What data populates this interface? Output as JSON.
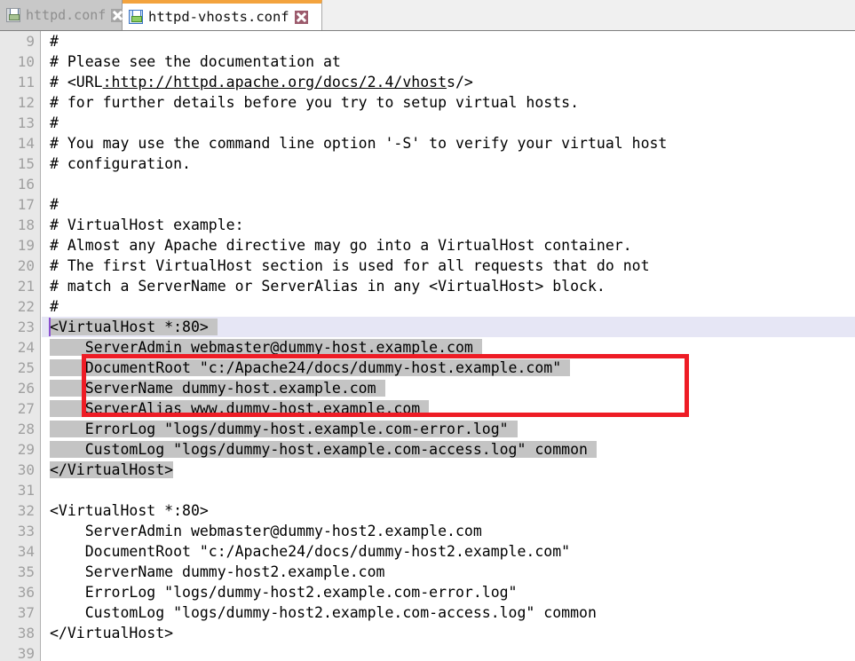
{
  "window": {
    "title": "httpd-vhosts.conf",
    "accent_orange": "#f3a33e",
    "selection_color": "#c4c4c4",
    "current_line_color": "#e6e6f5",
    "annotation_color": "#ee1c25"
  },
  "tabs": [
    {
      "label": "httpd.conf",
      "icon": "floppy-disk-icon",
      "close_icon": "close-icon",
      "active": false
    },
    {
      "label": "httpd-vhosts.conf",
      "icon": "floppy-disk-icon",
      "close_icon": "close-icon",
      "active": true
    }
  ],
  "editor": {
    "first_line_number": 9,
    "lines": [
      {
        "n": 9,
        "text": "#"
      },
      {
        "n": 10,
        "text": "# Please see the documentation at"
      },
      {
        "n": 11,
        "text": "# <URL:http://httpd.apache.org/docs/2.4/vhosts/>",
        "link_from": 6,
        "link_to": 45
      },
      {
        "n": 12,
        "text": "# for further details before you try to setup virtual hosts."
      },
      {
        "n": 13,
        "text": "#"
      },
      {
        "n": 14,
        "text": "# You may use the command line option '-S' to verify your virtual host"
      },
      {
        "n": 15,
        "text": "# configuration."
      },
      {
        "n": 16,
        "text": ""
      },
      {
        "n": 17,
        "text": "#"
      },
      {
        "n": 18,
        "text": "# VirtualHost example:"
      },
      {
        "n": 19,
        "text": "# Almost any Apache directive may go into a VirtualHost container."
      },
      {
        "n": 20,
        "text": "# The first VirtualHost section is used for all requests that do not"
      },
      {
        "n": 21,
        "text": "# match a ServerName or ServerAlias in any <VirtualHost> block."
      },
      {
        "n": 22,
        "text": "#"
      },
      {
        "n": 23,
        "text": "<VirtualHost *:80>",
        "selected": true,
        "sel_pad": 1,
        "current": true,
        "caret": true
      },
      {
        "n": 24,
        "text": "    ServerAdmin webmaster@dummy-host.example.com",
        "selected": true,
        "sel_pad": 1
      },
      {
        "n": 25,
        "text": "    DocumentRoot \"c:/Apache24/docs/dummy-host.example.com\"",
        "selected": true,
        "sel_pad": 1
      },
      {
        "n": 26,
        "text": "    ServerName dummy-host.example.com",
        "selected": true,
        "sel_pad": 1
      },
      {
        "n": 27,
        "text": "    ServerAlias www.dummy-host.example.com",
        "selected": true,
        "sel_pad": 1
      },
      {
        "n": 28,
        "text": "    ErrorLog \"logs/dummy-host.example.com-error.log\"",
        "selected": true,
        "sel_pad": 1
      },
      {
        "n": 29,
        "text": "    CustomLog \"logs/dummy-host.example.com-access.log\" common",
        "selected": true,
        "sel_pad": 1
      },
      {
        "n": 30,
        "text": "</VirtualHost>",
        "selected": true,
        "sel_pad": 0
      },
      {
        "n": 31,
        "text": ""
      },
      {
        "n": 32,
        "text": "<VirtualHost *:80>"
      },
      {
        "n": 33,
        "text": "    ServerAdmin webmaster@dummy-host2.example.com"
      },
      {
        "n": 34,
        "text": "    DocumentRoot \"c:/Apache24/docs/dummy-host2.example.com\""
      },
      {
        "n": 35,
        "text": "    ServerName dummy-host2.example.com"
      },
      {
        "n": 36,
        "text": "    ErrorLog \"logs/dummy-host2.example.com-error.log\""
      },
      {
        "n": 37,
        "text": "    CustomLog \"logs/dummy-host2.example.com-access.log\" common"
      },
      {
        "n": 38,
        "text": "</VirtualHost>"
      },
      {
        "n": 39,
        "text": ""
      }
    ],
    "annotation": {
      "type": "rectangle-highlight",
      "covers_lines": [
        25,
        26,
        27
      ]
    }
  }
}
